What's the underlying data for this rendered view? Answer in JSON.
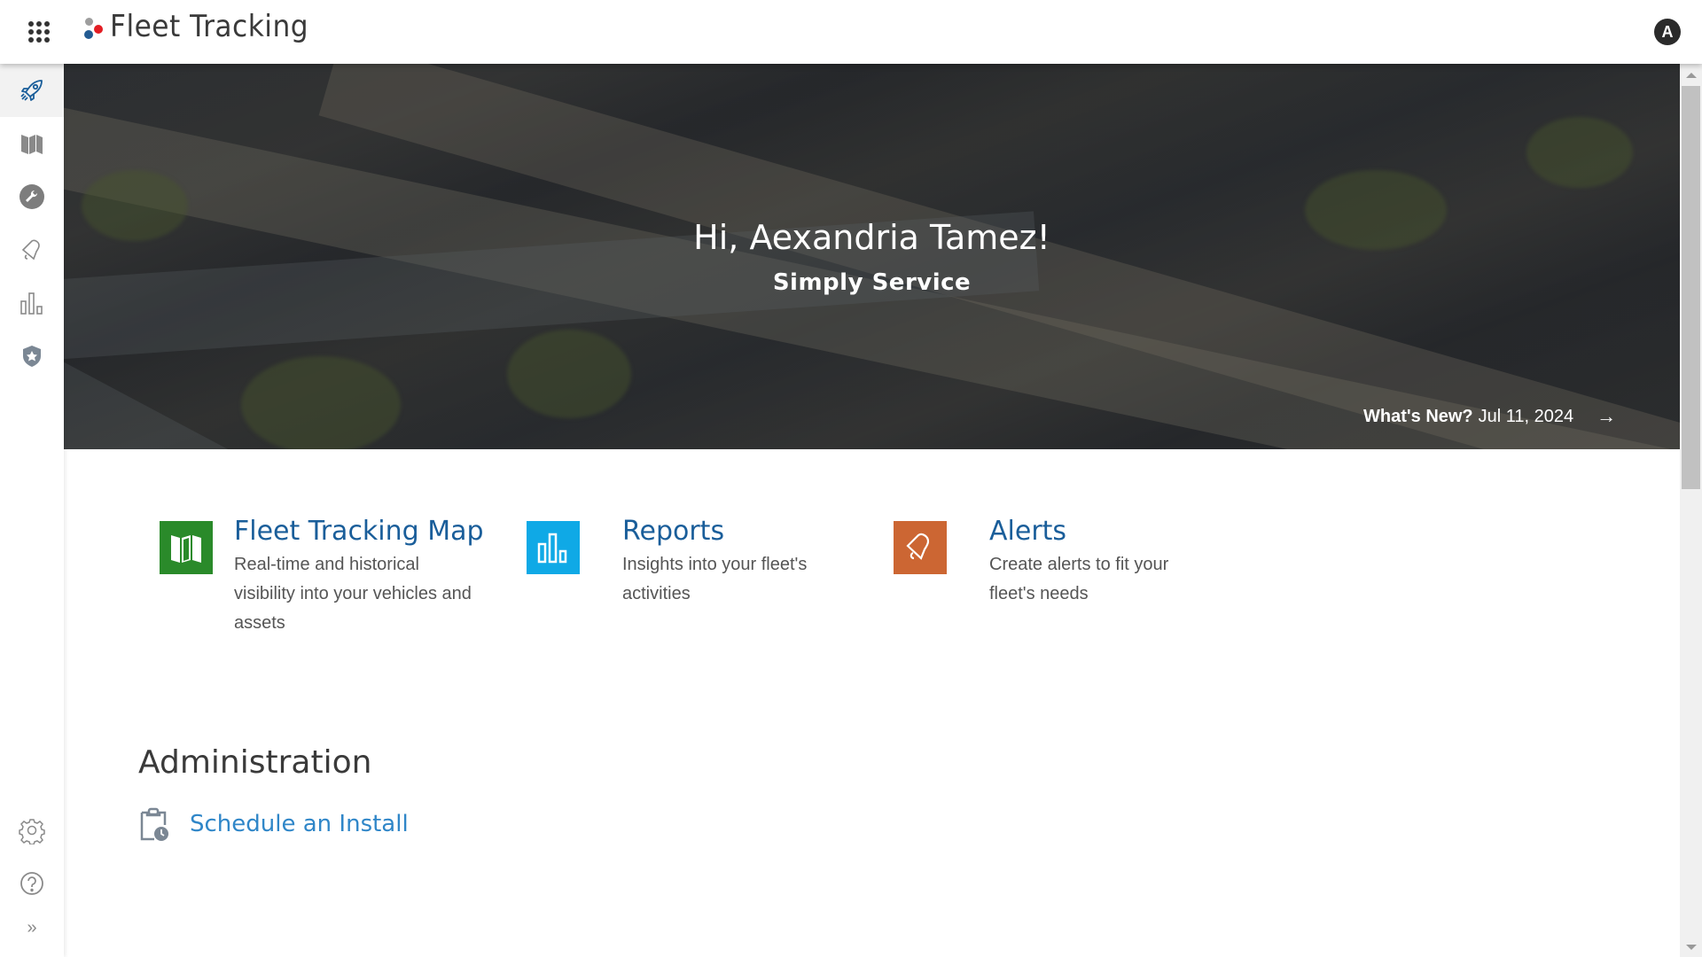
{
  "header": {
    "app_title": "Fleet Tracking",
    "avatar_initial": "A",
    "apps_icon": "grid-dots-icon",
    "logo_colors": [
      "#9e9e9e",
      "#e31e24",
      "#235b92"
    ]
  },
  "sidebar": {
    "items": [
      {
        "name": "get-started",
        "icon": "rocket-icon",
        "active": true
      },
      {
        "name": "map",
        "icon": "map-icon",
        "active": false
      },
      {
        "name": "service",
        "icon": "wrench-icon",
        "active": false
      },
      {
        "name": "alerts",
        "icon": "bell-icon",
        "active": false
      },
      {
        "name": "reports",
        "icon": "bar-chart-icon",
        "active": false
      },
      {
        "name": "admin",
        "icon": "shield-star-icon",
        "active": false
      }
    ],
    "bottom_items": [
      {
        "name": "settings",
        "icon": "gear-icon"
      },
      {
        "name": "help",
        "icon": "help-circle-icon"
      },
      {
        "name": "expand",
        "icon": "double-chevron-right-icon",
        "label": "»"
      }
    ]
  },
  "banner": {
    "greeting": "Hi, Aexandria Tamez!",
    "company": "Simply Service",
    "whats_new_label": "What's New?",
    "whats_new_date": "Jul 11, 2024",
    "arrow": "→"
  },
  "features": [
    {
      "title": "Fleet Tracking Map",
      "description": "Real-time and historical visibility into your vehicles and assets",
      "icon": "map-icon",
      "color": "#2a8a2a"
    },
    {
      "title": "Reports",
      "description": "Insights into your fleet's activities",
      "icon": "bar-chart-icon",
      "color": "#0fa9e6"
    },
    {
      "title": "Alerts",
      "description": "Create alerts to fit your fleet's needs",
      "icon": "bell-icon",
      "color": "#cc6633"
    }
  ],
  "administration": {
    "heading": "Administration",
    "links": [
      {
        "label": "Schedule an Install",
        "icon": "clipboard-clock-icon"
      }
    ]
  },
  "colors": {
    "accent": "#1a5e9a",
    "link": "#2f86c8"
  }
}
